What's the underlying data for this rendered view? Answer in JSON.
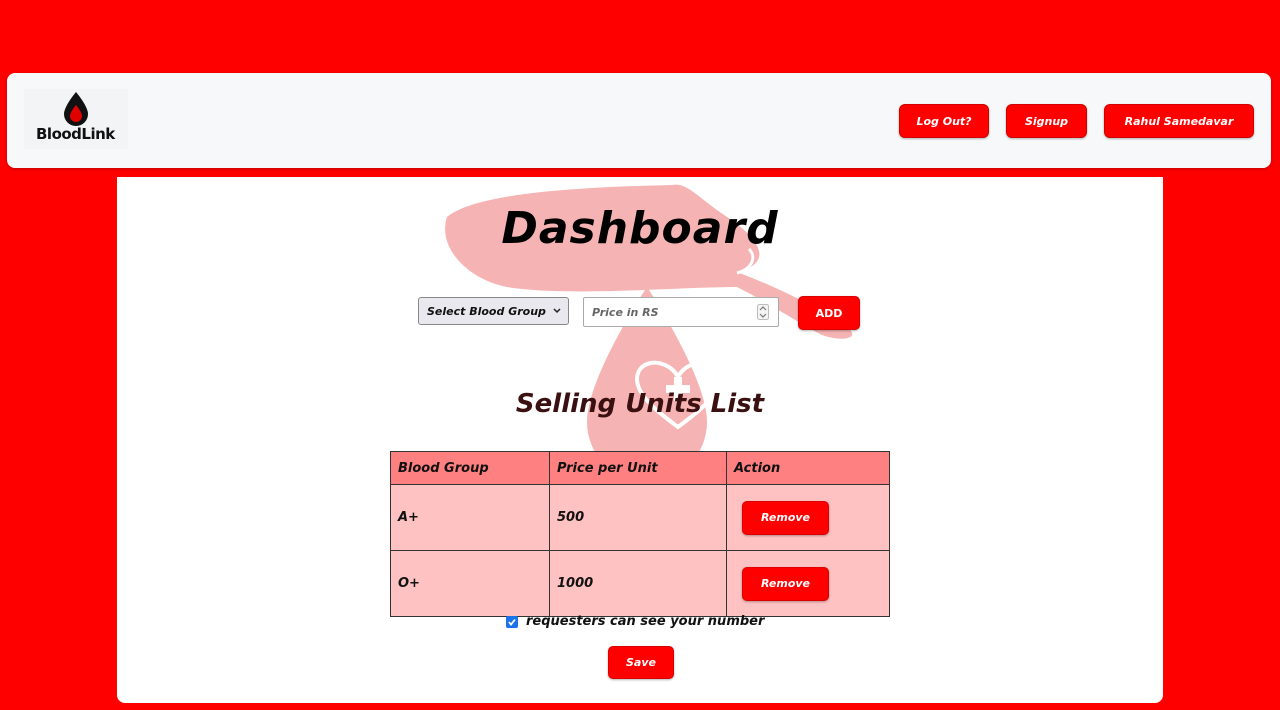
{
  "brand": {
    "logo_text": "BloodLink",
    "logo_icon": "blood-drop-icon"
  },
  "nav": {
    "logout_label": "Log Out?",
    "signup_label": "Signup",
    "user_label": "Rahul Samedavar"
  },
  "page": {
    "title": "Dashboard"
  },
  "add_form": {
    "select_value": "Select Blood Group",
    "price_placeholder": "Price in RS",
    "add_label": "ADD"
  },
  "units": {
    "title": "Selling Units List",
    "headers": [
      "Blood Group",
      "Price per Unit",
      "Action"
    ],
    "rows": [
      {
        "group": "A+",
        "price": "500",
        "action": "Remove"
      },
      {
        "group": "O+",
        "price": "1000",
        "action": "Remove"
      }
    ]
  },
  "settings": {
    "show_number_label": "requesters can see your number",
    "show_number_checked": true,
    "save_label": "Save"
  },
  "colors": {
    "background": "#ff0000",
    "accent": "#ff0000",
    "table_header": "#ff8080",
    "table_cell": "#ffc2c2",
    "checkbox": "#1a73e8"
  }
}
